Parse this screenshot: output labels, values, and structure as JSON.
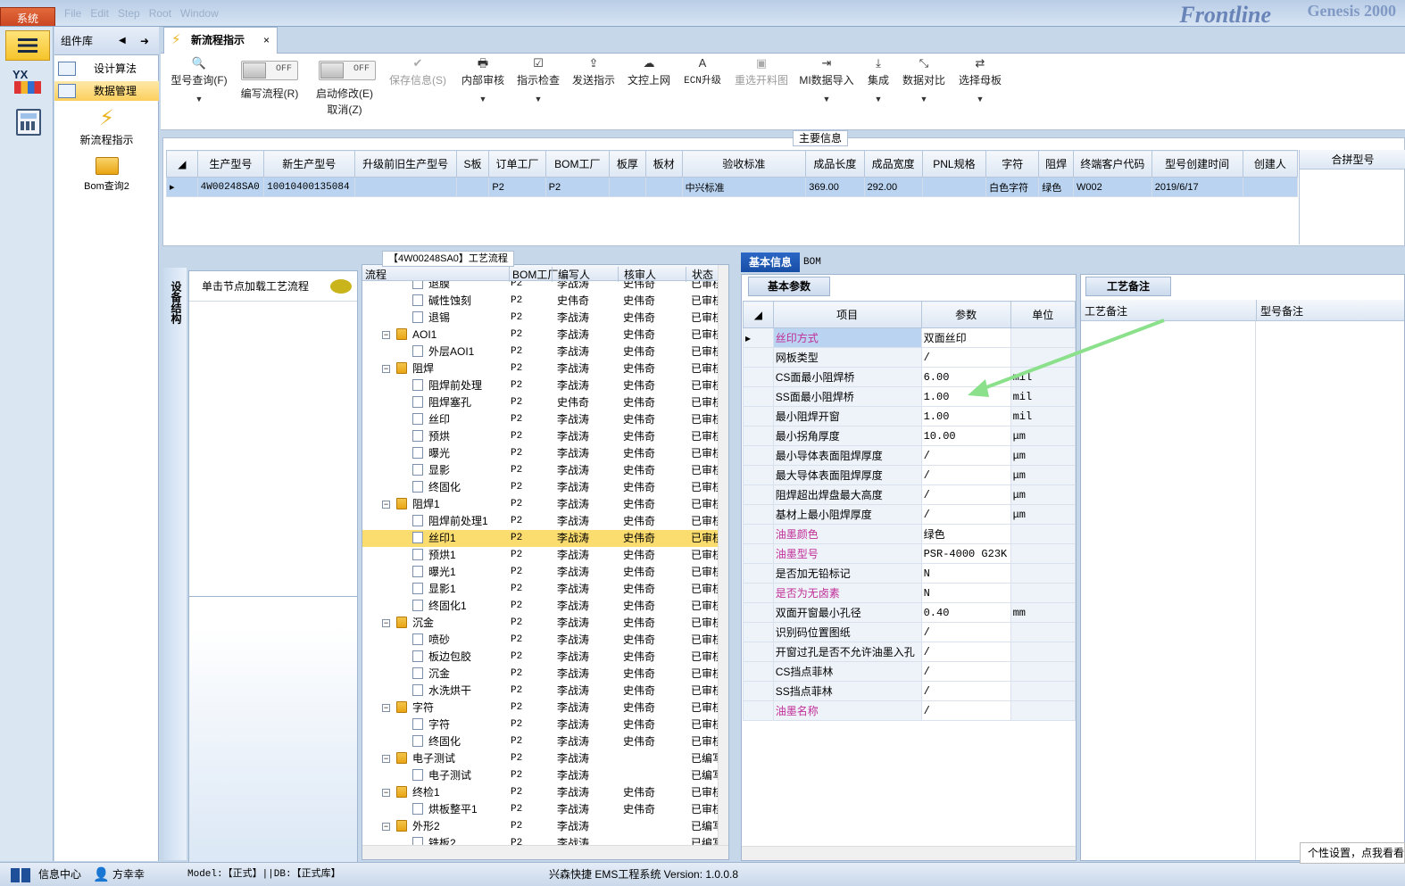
{
  "titlebar": {
    "system_menu": "系统",
    "brand": "Frontline",
    "brand2": "Genesis 2000"
  },
  "component_panel": {
    "title": "组件库",
    "items": [
      {
        "label": "设计算法"
      },
      {
        "label": "数据管理"
      }
    ],
    "launchers": [
      {
        "label": "新流程指示"
      },
      {
        "label": "Bom查询2"
      }
    ]
  },
  "tab": {
    "label": "新流程指示",
    "close": "×"
  },
  "toolbar": {
    "model_query": "型号查询(F)",
    "toggle_text": "OFF",
    "edit_flow": "编写流程(R)",
    "enable_edit": "启动修改(E)",
    "cancel": "取消(Z)",
    "save_info": "保存信息(S)",
    "internal_review": "内部审核",
    "instruction_check": "指示检查",
    "send_instruction": "发送指示",
    "doc_online": "文控上网",
    "ecn_upgrade": "ECN升级",
    "reselect_drawing": "重选开料图",
    "mi_import": "MI数据导入",
    "integrate": "集成",
    "data_compare": "数据对比",
    "select_master": "选择母板"
  },
  "main_info": {
    "title": "主要信息",
    "columns": [
      "生产型号",
      "新生产型号",
      "升级前旧生产型号",
      "S板",
      "订单工厂",
      "BOM工厂",
      "板厚",
      "板材",
      "验收标准",
      "成品长度",
      "成品宽度",
      "PNL规格",
      "字符",
      "阻焊",
      "终端客户代码",
      "型号创建时间",
      "创建人"
    ],
    "row": [
      "4W00248SA0",
      "10010400135084",
      "",
      "",
      "P2",
      "P2",
      "",
      "",
      "中兴标准",
      "369.00",
      "292.00",
      "",
      "白色字符",
      "绿色",
      "W002",
      "2019/6/17",
      ""
    ],
    "merge_header": "合拼型号"
  },
  "device": {
    "label": "设备结构",
    "hint": "单击节点加载工艺流程"
  },
  "process": {
    "title": "【4W00248SA0】工艺流程",
    "columns": [
      "流程",
      "BOM工厂",
      "编写人",
      "核审人",
      "状态"
    ],
    "rows": [
      {
        "level": 2,
        "type": "file",
        "name": "退膜",
        "bom": "P2",
        "writer": "李战涛",
        "reviewer": "史伟奇",
        "status": "已审核"
      },
      {
        "level": 2,
        "type": "file",
        "name": "碱性蚀刻",
        "bom": "P2",
        "writer": "史伟奇",
        "reviewer": "史伟奇",
        "status": "已审核"
      },
      {
        "level": 2,
        "type": "file",
        "name": "退锡",
        "bom": "P2",
        "writer": "李战涛",
        "reviewer": "史伟奇",
        "status": "已审核"
      },
      {
        "level": 1,
        "type": "folder",
        "name": "AOI1",
        "bom": "P2",
        "writer": "李战涛",
        "reviewer": "史伟奇",
        "status": "已审核"
      },
      {
        "level": 2,
        "type": "file",
        "name": "外层AOI1",
        "bom": "P2",
        "writer": "李战涛",
        "reviewer": "史伟奇",
        "status": "已审核"
      },
      {
        "level": 1,
        "type": "folder",
        "name": "阻焊",
        "bom": "P2",
        "writer": "李战涛",
        "reviewer": "史伟奇",
        "status": "已审核"
      },
      {
        "level": 2,
        "type": "file",
        "name": "阻焊前处理",
        "bom": "P2",
        "writer": "李战涛",
        "reviewer": "史伟奇",
        "status": "已审核"
      },
      {
        "level": 2,
        "type": "file",
        "name": "阻焊塞孔",
        "bom": "P2",
        "writer": "史伟奇",
        "reviewer": "史伟奇",
        "status": "已审核"
      },
      {
        "level": 2,
        "type": "file",
        "name": "丝印",
        "bom": "P2",
        "writer": "李战涛",
        "reviewer": "史伟奇",
        "status": "已审核"
      },
      {
        "level": 2,
        "type": "file",
        "name": "预烘",
        "bom": "P2",
        "writer": "李战涛",
        "reviewer": "史伟奇",
        "status": "已审核"
      },
      {
        "level": 2,
        "type": "file",
        "name": "曝光",
        "bom": "P2",
        "writer": "李战涛",
        "reviewer": "史伟奇",
        "status": "已审核"
      },
      {
        "level": 2,
        "type": "file",
        "name": "显影",
        "bom": "P2",
        "writer": "李战涛",
        "reviewer": "史伟奇",
        "status": "已审核"
      },
      {
        "level": 2,
        "type": "file",
        "name": "终固化",
        "bom": "P2",
        "writer": "李战涛",
        "reviewer": "史伟奇",
        "status": "已审核"
      },
      {
        "level": 1,
        "type": "folder",
        "name": "阻焊1",
        "bom": "P2",
        "writer": "李战涛",
        "reviewer": "史伟奇",
        "status": "已审核"
      },
      {
        "level": 2,
        "type": "file",
        "name": "阻焊前处理1",
        "bom": "P2",
        "writer": "李战涛",
        "reviewer": "史伟奇",
        "status": "已审核"
      },
      {
        "level": 2,
        "type": "file",
        "name": "丝印1",
        "bom": "P2",
        "writer": "李战涛",
        "reviewer": "史伟奇",
        "status": "已审核",
        "selected": true
      },
      {
        "level": 2,
        "type": "file",
        "name": "预烘1",
        "bom": "P2",
        "writer": "李战涛",
        "reviewer": "史伟奇",
        "status": "已审核"
      },
      {
        "level": 2,
        "type": "file",
        "name": "曝光1",
        "bom": "P2",
        "writer": "李战涛",
        "reviewer": "史伟奇",
        "status": "已审核"
      },
      {
        "level": 2,
        "type": "file",
        "name": "显影1",
        "bom": "P2",
        "writer": "李战涛",
        "reviewer": "史伟奇",
        "status": "已审核"
      },
      {
        "level": 2,
        "type": "file",
        "name": "终固化1",
        "bom": "P2",
        "writer": "李战涛",
        "reviewer": "史伟奇",
        "status": "已审核"
      },
      {
        "level": 1,
        "type": "folder",
        "name": "沉金",
        "bom": "P2",
        "writer": "李战涛",
        "reviewer": "史伟奇",
        "status": "已审核"
      },
      {
        "level": 2,
        "type": "file",
        "name": "喷砂",
        "bom": "P2",
        "writer": "李战涛",
        "reviewer": "史伟奇",
        "status": "已审核"
      },
      {
        "level": 2,
        "type": "file",
        "name": "板边包胶",
        "bom": "P2",
        "writer": "李战涛",
        "reviewer": "史伟奇",
        "status": "已审核"
      },
      {
        "level": 2,
        "type": "file",
        "name": "沉金",
        "bom": "P2",
        "writer": "李战涛",
        "reviewer": "史伟奇",
        "status": "已审核"
      },
      {
        "level": 2,
        "type": "file",
        "name": "水洗烘干",
        "bom": "P2",
        "writer": "李战涛",
        "reviewer": "史伟奇",
        "status": "已审核"
      },
      {
        "level": 1,
        "type": "folder",
        "name": "字符",
        "bom": "P2",
        "writer": "李战涛",
        "reviewer": "史伟奇",
        "status": "已审核"
      },
      {
        "level": 2,
        "type": "file",
        "name": "字符",
        "bom": "P2",
        "writer": "李战涛",
        "reviewer": "史伟奇",
        "status": "已审核"
      },
      {
        "level": 2,
        "type": "file",
        "name": "终固化",
        "bom": "P2",
        "writer": "李战涛",
        "reviewer": "史伟奇",
        "status": "已审核"
      },
      {
        "level": 1,
        "type": "folder",
        "name": "电子测试",
        "bom": "P2",
        "writer": "李战涛",
        "reviewer": "",
        "status": "已编写"
      },
      {
        "level": 2,
        "type": "file",
        "name": "电子测试",
        "bom": "P2",
        "writer": "李战涛",
        "reviewer": "",
        "status": "已编写"
      },
      {
        "level": 1,
        "type": "folder",
        "name": "终检1",
        "bom": "P2",
        "writer": "李战涛",
        "reviewer": "史伟奇",
        "status": "已审核"
      },
      {
        "level": 2,
        "type": "file",
        "name": "烘板整平1",
        "bom": "P2",
        "writer": "李战涛",
        "reviewer": "史伟奇",
        "status": "已审核"
      },
      {
        "level": 1,
        "type": "folder",
        "name": "外形2",
        "bom": "P2",
        "writer": "李战涛",
        "reviewer": "",
        "status": "已编写"
      },
      {
        "level": 2,
        "type": "file",
        "name": "铣板2",
        "bom": "P2",
        "writer": "李战涛",
        "reviewer": "",
        "status": "已编写"
      }
    ]
  },
  "basic_info": {
    "tab_basic": "基本信息",
    "tab_bom": "BOM",
    "sub_tab": "基本参数",
    "columns": [
      "项目",
      "参数",
      "单位"
    ],
    "rows": [
      {
        "item": "丝印方式",
        "value": "双面丝印",
        "unit": "",
        "pink": true
      },
      {
        "item": "网板类型",
        "value": "/",
        "unit": ""
      },
      {
        "item": "CS面最小阻焊桥",
        "value": "6.00",
        "unit": "mil"
      },
      {
        "item": "SS面最小阻焊桥",
        "value": "1.00",
        "unit": "mil"
      },
      {
        "item": "最小阻焊开窗",
        "value": "1.00",
        "unit": "mil"
      },
      {
        "item": "最小拐角厚度",
        "value": "10.00",
        "unit": "μm"
      },
      {
        "item": "最小导体表面阻焊厚度",
        "value": "/",
        "unit": "μm"
      },
      {
        "item": "最大导体表面阻焊厚度",
        "value": "/",
        "unit": "μm"
      },
      {
        "item": "阻焊超出焊盘最大高度",
        "value": "/",
        "unit": "μm"
      },
      {
        "item": "基材上最小阻焊厚度",
        "value": "/",
        "unit": "μm"
      },
      {
        "item": "油墨颜色",
        "value": "绿色",
        "unit": "",
        "pink": true
      },
      {
        "item": "油墨型号",
        "value": "PSR-4000 G23K",
        "unit": "",
        "pink": true
      },
      {
        "item": "是否加无铅标记",
        "value": "N",
        "unit": ""
      },
      {
        "item": "是否为无卤素",
        "value": "N",
        "unit": "",
        "pink": true
      },
      {
        "item": "双面开窗最小孔径",
        "value": "0.40",
        "unit": "mm"
      },
      {
        "item": "识别码位置图纸",
        "value": "/",
        "unit": ""
      },
      {
        "item": "开窗过孔是否不允许油墨入孔",
        "value": "/",
        "unit": ""
      },
      {
        "item": "CS挡点菲林",
        "value": "/",
        "unit": ""
      },
      {
        "item": "SS挡点菲林",
        "value": "/",
        "unit": ""
      },
      {
        "item": "油墨名称",
        "value": "/",
        "unit": "",
        "pink": true
      }
    ]
  },
  "remarks": {
    "tab": "工艺备注",
    "col1": "工艺备注",
    "col2": "型号备注"
  },
  "statusbar": {
    "info_center": "信息中心",
    "user": "方幸幸",
    "model_db": "Model:【正式】||DB:【正式库】",
    "app": "兴森快捷 EMS工程系统 Version: 1.0.0.8"
  },
  "tooltip": {
    "text": "个性设置，点我看看"
  },
  "colors": {
    "accent": "#2b67c6",
    "selected_row": "#b9d3f0",
    "highlight": "#fbdc6e",
    "pink_label": "#c12d98",
    "arrow": "#8be08b"
  }
}
